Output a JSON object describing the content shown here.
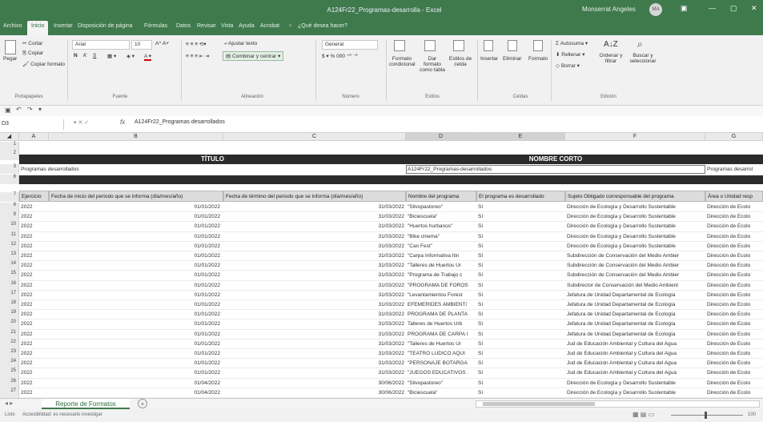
{
  "window": {
    "title": "A124Fr22_Programas-desarrolla - Excel",
    "user": "Monserrat Angeles",
    "avatar": "MA",
    "minimize": "—",
    "restore": "▢",
    "close": "✕"
  },
  "tabs": [
    "Archivo",
    "Inicio",
    "Insertar",
    "Disposición de página",
    "Fórmulas",
    "Datos",
    "Revisar",
    "Vista",
    "Ayuda",
    "Acrobat",
    "¿Qué desea hacer?"
  ],
  "ribbon": {
    "clipboard": {
      "paste": "Pegar",
      "cut": "Cortar",
      "copy": "Copiar",
      "format_painter": "Copiar formato",
      "group": "Portapapeles"
    },
    "font": {
      "name": "Arial",
      "size": "10",
      "bold": "N",
      "italic": "K",
      "underline": "S",
      "group": "Fuente"
    },
    "alignment": {
      "wrap": "Ajustar texto",
      "merge": "Combinar y centrar",
      "group": "Alineación"
    },
    "number": {
      "format": "General",
      "group": "Número"
    },
    "styles": {
      "cond": "Formato condicional",
      "table": "Dar formato como tabla",
      "cell": "Estilos de celda",
      "group": "Estilos"
    },
    "cells": {
      "insert": "Insertar",
      "delete": "Eliminar",
      "format": "Formato",
      "group": "Celdas"
    },
    "editing": {
      "autosum": "Autosuma",
      "fill": "Rellenar",
      "clear": "Borrar",
      "sort": "Ordenar y filtrar",
      "find": "Buscar y seleccionar",
      "group": "Edición"
    }
  },
  "namebox": "D3",
  "formula": "A124Fr22_Programas desarrollados",
  "columns": [
    "A",
    "B",
    "C",
    "D",
    "E",
    "F",
    "G"
  ],
  "rows": {
    "r2": {
      "titulo": "TÍTULO",
      "nombre_corto": "NOMBRE CORTO"
    },
    "r3": {
      "a": "Programas desarrollados",
      "d": "A124Fr22_Programas-desarrollados",
      "g": "Programas desarrol"
    },
    "headers": [
      "Ejercicio",
      "Fecha de inicio del periodo que se informa (día/mes/año)",
      "Fecha de término del periodo que se informa (día/mes/año)",
      "Nombre del programa",
      "El programa es desarrollado",
      "Sujeto Obligado corresponsable del programa",
      "Área o Unidad resp"
    ]
  },
  "data": [
    {
      "n": "8",
      "a": "2022",
      "b": "01/01/2022",
      "c": "31/03/2022",
      "d": "\"Silvopastoreo\"",
      "e": "Sí",
      "f": "Dirección de Ecología y Desarrollo Sustentable",
      "g": "Dirección de Ecolo"
    },
    {
      "n": "9",
      "a": "2022",
      "b": "01/01/2022",
      "c": "31/03/2022",
      "d": "\"Biciescuela\"",
      "e": "Sí",
      "f": "Dirección de Ecología y Desarrollo Sustentable",
      "g": "Dirección de Ecolo"
    },
    {
      "n": "10",
      "a": "2022",
      "b": "01/01/2022",
      "c": "31/03/2022",
      "d": "\"Huertos hurbanos\"",
      "e": "Sí",
      "f": "Dirección de Ecología y Desarrollo Sustentable",
      "g": "Dirección de Ecolo"
    },
    {
      "n": "11",
      "a": "2022",
      "b": "01/01/2022",
      "c": "31/03/2022",
      "d": "\"Bike cinema\"",
      "e": "Sí",
      "f": "Dirección de Ecología y Desarrollo Sustentable",
      "g": "Dirección de Ecolo"
    },
    {
      "n": "12",
      "a": "2022",
      "b": "01/01/2022",
      "c": "31/03/2022",
      "d": "\"Can Fest\"",
      "e": "Sí",
      "f": "Dirección de Ecología y Desarrollo Sustentable",
      "g": "Dirección de Ecolo"
    },
    {
      "n": "13",
      "a": "2022",
      "b": "01/01/2022",
      "c": "31/03/2022",
      "d": "\"Carpa Informativa Itin",
      "e": "Sí",
      "f": "Subdirección de Conservación del Medio Ambier",
      "g": "Dirección de Ecolo"
    },
    {
      "n": "14",
      "a": "2022",
      "b": "01/01/2022",
      "c": "31/03/2022",
      "d": "\"Talleres de Huertos Ur",
      "e": "Sí",
      "f": "Subdirección de Conservación del Medio Ambier",
      "g": "Dirección de Ecolo"
    },
    {
      "n": "15",
      "a": "2022",
      "b": "01/01/2022",
      "c": "31/03/2022",
      "d": "\"Programa de Trabajo c",
      "e": "Sí",
      "f": "Subdirección de Conservación del Medio Ambier",
      "g": "Dirección de Ecolo"
    },
    {
      "n": "16",
      "a": "2022",
      "b": "01/01/2022",
      "c": "31/03/2022",
      "d": "\"PROGRAMA DE FOROS",
      "e": "Sí",
      "f": "Subdirector de Conservación del Medio Ambient",
      "g": "Dirección de Ecolo"
    },
    {
      "n": "17",
      "a": "2022",
      "b": "01/01/2022",
      "c": "31/03/2022",
      "d": "\"Levantamientos Forest",
      "e": "Sí",
      "f": "Jefatura de Unidad Departamental de Ecología",
      "g": "Dirección de Ecolo"
    },
    {
      "n": "18",
      "a": "2022",
      "b": "01/01/2022",
      "c": "31/03/2022",
      "d": "EFEMERIDES AMBIENT/",
      "e": "Sí",
      "f": "Jefatura de Unidad Departamental de Ecología",
      "g": "Dirección de Ecolo"
    },
    {
      "n": "19",
      "a": "2022",
      "b": "01/01/2022",
      "c": "31/03/2022",
      "d": "PROGRAMA DE PLANTA",
      "e": "Sí",
      "f": "Jefatura de Unidad Departamental de Ecología",
      "g": "Dirección de Ecolo"
    },
    {
      "n": "20",
      "a": "2022",
      "b": "01/01/2022",
      "c": "31/03/2022",
      "d": "Talleres de Huertos Urb",
      "e": "Sí",
      "f": "Jefatura de Unidad Departamental de Ecología",
      "g": "Dirección de Ecolo"
    },
    {
      "n": "21",
      "a": "2022",
      "b": "01/01/2022",
      "c": "31/03/2022",
      "d": "PROGRAMA DE CARPA I",
      "e": "Sí",
      "f": "Jefatura de Unidad Departamental de Ecología",
      "g": "Dirección de Ecolo"
    },
    {
      "n": "22",
      "a": "2022",
      "b": "01/01/2022",
      "c": "31/03/2022",
      "d": "\"Talleres de Huertos Ur",
      "e": "Sí",
      "f": "Jud de Educación Ambiental y Cultura del Agua",
      "g": "Dirección de Ecolo"
    },
    {
      "n": "23",
      "a": "2022",
      "b": "01/01/2022",
      "c": "31/03/2022",
      "d": "\"TEATRO LUDICO AQUI",
      "e": "Sí",
      "f": "Jud de Educación Ambiental y Cultura del Agua",
      "g": "Dirección de Ecolo"
    },
    {
      "n": "24",
      "a": "2022",
      "b": "01/01/2022",
      "c": "31/03/2022",
      "d": "\"PERSONAJE BOTARGA",
      "e": "Sí",
      "f": "Jud de Educación Ambiental y Cultura del Agua",
      "g": "Dirección de Ecolo"
    },
    {
      "n": "25",
      "a": "2022",
      "b": "01/01/2022",
      "c": "31/03/2022",
      "d": "\"JUEGOS EDUCATIVOS .",
      "e": "Sí",
      "f": "Jud de Educación Ambiental y Cultura del Agua",
      "g": "Dirección de Ecolo"
    },
    {
      "n": "26",
      "a": "2022",
      "b": "01/04/2022",
      "c": "30/06/2022",
      "d": "\"Silvopastoreo\"",
      "e": "Sí",
      "f": "Dirección de Ecología y Desarrollo Sustentable",
      "g": "Dirección de Ecolo"
    },
    {
      "n": "27",
      "a": "2022",
      "b": "01/04/2022",
      "c": "30/06/2022",
      "d": "\"Biciescuela\"",
      "e": "Sí",
      "f": "Dirección de Ecología y Desarrollo Sustentable",
      "g": "Dirección de Ecolo"
    }
  ],
  "sheet": {
    "tab": "Reporte de Formatos",
    "add": "+"
  },
  "status": {
    "ready": "Listo",
    "accessibility": "Accesibilidad: es necesario investigar",
    "zoom": "100"
  }
}
